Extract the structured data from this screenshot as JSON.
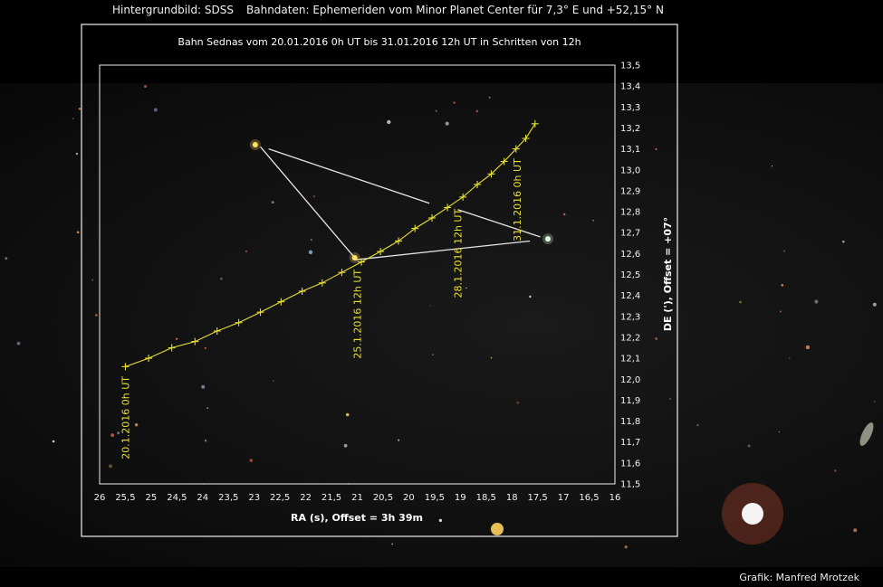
{
  "header": {
    "background": "Hintergrundbild: SDSS",
    "orbit_data": "Bahndaten: Ephemeriden vom Minor Planet Center für 7,3° E und +52,15° N"
  },
  "footer": {
    "credit": "Grafik: Manfred Mrotzek"
  },
  "chart_data": {
    "type": "line",
    "title": "Bahn Sednas vom 20.01.2016 0h UT bis 31.01.2016 12h UT in Schritten von 12h",
    "xlabel": "RA (s), Offset = 3h 39m",
    "ylabel": "DE ('), Offset = +07°",
    "xlim": [
      26,
      16
    ],
    "ylim": [
      11.5,
      13.5
    ],
    "grid": false,
    "x_reversed": true,
    "x_ticks": [
      "26",
      "25,5",
      "25",
      "24,5",
      "24",
      "23,5",
      "23",
      "22,5",
      "22",
      "21,5",
      "21",
      "20,5",
      "20",
      "19,5",
      "19",
      "18,5",
      "18",
      "17,5",
      "17",
      "16,5",
      "16"
    ],
    "y_ticks": [
      "11,5",
      "11,6",
      "11,7",
      "11,8",
      "11,9",
      "12,0",
      "12,1",
      "12,2",
      "12,3",
      "12,4",
      "12,5",
      "12,6",
      "12,7",
      "12,8",
      "12,9",
      "13,0",
      "13,1",
      "13,2",
      "13,3",
      "13,4",
      "13,5"
    ],
    "series": [
      {
        "color": "#e8e030",
        "marker": "+",
        "x": [
          25.5,
          25.05,
          24.6,
          24.15,
          23.72,
          23.3,
          22.88,
          22.48,
          22.07,
          21.68,
          21.3,
          20.92,
          20.55,
          20.2,
          19.88,
          19.55,
          19.25,
          18.95,
          18.67,
          18.4,
          18.15,
          17.92,
          17.73,
          17.55
        ],
        "y": [
          12.06,
          12.1,
          12.15,
          12.18,
          12.23,
          12.27,
          12.32,
          12.37,
          12.42,
          12.46,
          12.51,
          12.56,
          12.61,
          12.66,
          12.72,
          12.77,
          12.82,
          12.87,
          12.93,
          12.98,
          13.04,
          13.1,
          13.15,
          13.22
        ]
      }
    ],
    "annotations": [
      {
        "text": "20.1.2016 0h UT",
        "x": 25.5,
        "y": 12.04
      },
      {
        "text": "25.1.2016 12h UT",
        "x": 21.0,
        "y": 12.55
      },
      {
        "text": "28.1.2016 12h UT",
        "x": 19.05,
        "y": 12.84
      },
      {
        "text": "31.1.2016 0h UT",
        "x": 17.9,
        "y": 13.08
      }
    ],
    "pointer_lines": [
      {
        "x1": 22.88,
        "y1": 13.11,
        "x2": 21.05,
        "y2": 12.58
      },
      {
        "x1": 22.72,
        "y1": 13.1,
        "x2": 19.6,
        "y2": 12.84
      },
      {
        "x1": 19.05,
        "y1": 12.81,
        "x2": 17.45,
        "y2": 12.68
      },
      {
        "x1": 21.05,
        "y1": 12.57,
        "x2": 17.65,
        "y2": 12.66
      }
    ],
    "stars": [
      {
        "x": 22.98,
        "y": 13.12,
        "color": "#ffe060"
      },
      {
        "x": 21.05,
        "y": 12.58,
        "color": "#ffe060"
      },
      {
        "x": 17.3,
        "y": 12.67,
        "color": "#e0ffe0"
      }
    ]
  },
  "colors": {
    "curve": "#e8e030",
    "frame": "#f0f0f0",
    "pointer": "#e6e6e6"
  }
}
